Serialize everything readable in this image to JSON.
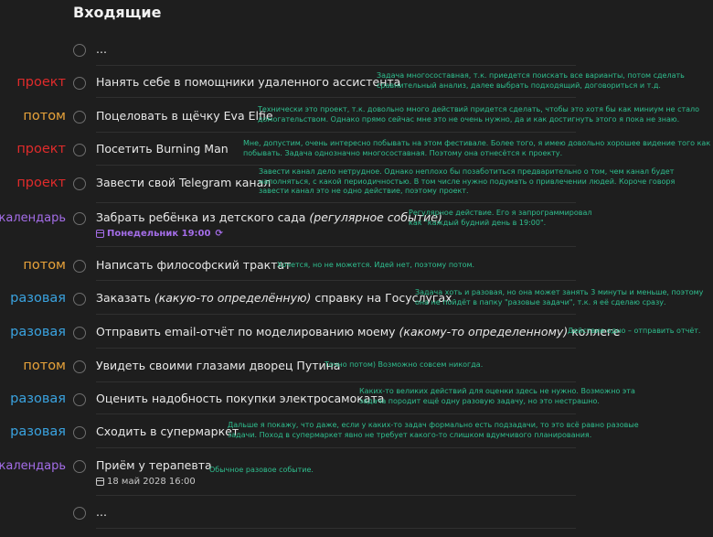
{
  "page": {
    "title": "Входящие"
  },
  "tasks": [
    {
      "tag": "",
      "title": "...",
      "note": ""
    },
    {
      "tag": "проект",
      "title": "Нанять себе в помощники удаленного ассистента",
      "note_l1": "Задача многосоставная, т.к. приедется поискать все варианты, потом сделать",
      "note_l2": "сравнительный анализ, далее выбрать подходящий, договориться и т.д."
    },
    {
      "tag": "потом",
      "title": "Поцеловать в щёчку Eva Elfie",
      "note_l1": "Технически это проект, т.к. довольно много действий придется сделать, чтобы это хотя бы как миниум не стало",
      "note_l2": "домогательством. Однако прямо сейчас мне это не очень нужно, да и как достигнуть этого я пока не знаю."
    },
    {
      "tag": "проект",
      "title": "Посетить Burning Man",
      "note_l1": "Мне, допустим, очень интересно побывать на этом фестивале. Более того, я имею довольно хорошее видение того как там",
      "note_l2": "побывать. Задача однозначно многосоставная. Поэтому она отнесётся к проекту."
    },
    {
      "tag": "проект",
      "title": "Завести свой Telegram канал",
      "note_l1": "Завести канал дело нетрудное. Однако неплохо бы позаботиться предварительно о том, чем канал будет",
      "note_l2": "наполняться, с какой периодичностью. В том числе нужно подумать о привлечении людей. Короче говоря",
      "note_l3": "завести канал это не одно действие, поэтому проект."
    },
    {
      "tag": "календарь",
      "title_a": "Забрать ребёнка из детского сада ",
      "title_b": "(регулярное событие)",
      "date": "Понедельник 19:00",
      "note_l1": "Регулярное действие. Его я запрограммировал",
      "note_l2": "как \"каждый будний день в 19:00\"."
    },
    {
      "tag": "потом",
      "title": "Написать философский трактат",
      "note_l1": "Хочется, но не можется. Идей нет, поэтому потом."
    },
    {
      "tag": "разовая",
      "title_a": "Заказать ",
      "title_b": "(какую-то определённую)",
      "title_c": " справку на Госуслугах",
      "note_l1": "Задача хоть и разовая, но она может занять 3 минуты и меньше, поэтому",
      "note_l2": "она не пойдёт в папку \"разовые задачи\", т.к. я её сделаю сразу."
    },
    {
      "tag": "разовая",
      "title_a": "Отправить email-отчёт по моделированию моему ",
      "title_b": "(какому-то определенному)",
      "title_c": " коллеге",
      "note_l1": "Действие одно – отправить отчёт."
    },
    {
      "tag": "потом",
      "title": "Увидеть своими глазами дворец Путина",
      "note_l1": "Точно потом) Возможно совсем никогда."
    },
    {
      "tag": "разовая",
      "title": "Оценить надобность покупки электросамоката",
      "note_l1": "Каких-то великих действий для оценки здесь не нужно. Возможно эта",
      "note_l2": "задача породит ещё одну разовую задачу, но это нестрашно."
    },
    {
      "tag": "разовая",
      "title": "Сходить в супермаркет",
      "note_l1": "Дальше я покажу, что даже, если у каких-то задач формально есть подзадачи, то это всё равно разовые",
      "note_l2": "задачи. Поход в супермаркет явно не требует какого-то слишком вдумчивого планирования."
    },
    {
      "tag": "календарь",
      "title": "Приём у терапевта",
      "date": "18 май 2028 16:00",
      "note_l1": "Обычное разовое событие."
    },
    {
      "tag": "",
      "title": "...",
      "note": ""
    }
  ],
  "colors": {
    "background": "#1e1e1e",
    "project": "#e02b2b",
    "later": "#e8a33a",
    "once": "#3aa3e0",
    "calendar": "#a46de8",
    "note": "#2fbf8f"
  }
}
